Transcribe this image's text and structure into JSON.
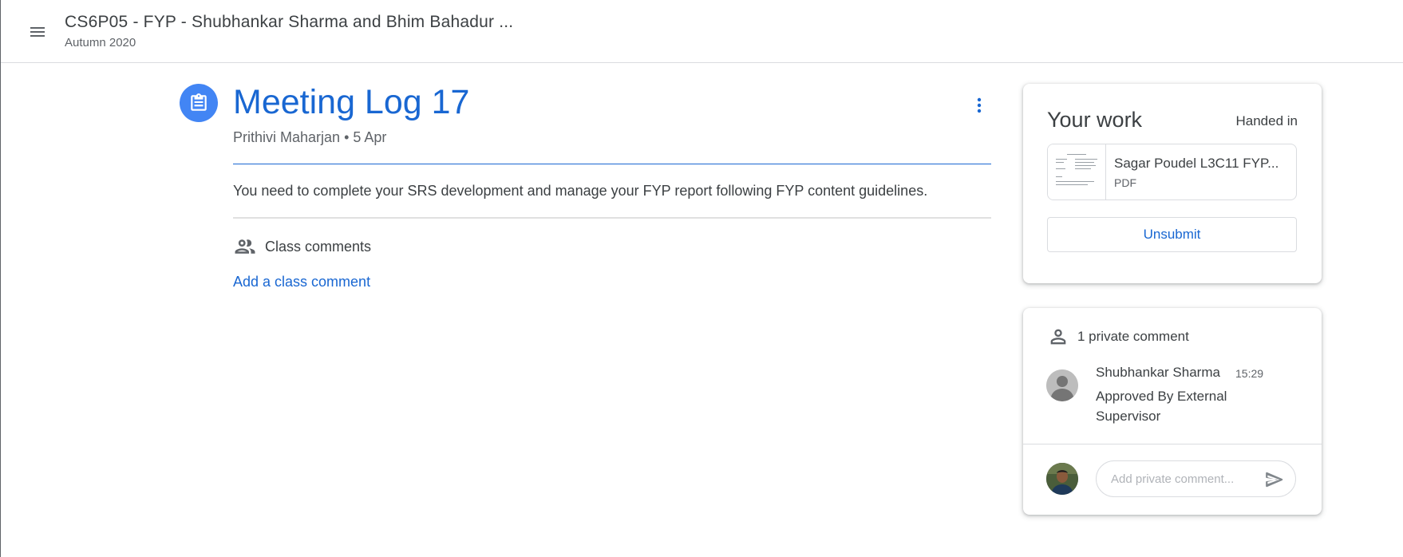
{
  "header": {
    "class_title": "CS6P05 - FYP - Shubhankar Sharma and Bhim Bahadur ...",
    "class_subtitle": "Autumn 2020"
  },
  "assignment": {
    "title": "Meeting Log 17",
    "author": "Prithivi Maharjan",
    "date": "5 Apr",
    "instructions": "You need to complete your SRS development and manage your FYP report following FYP content guidelines.",
    "class_comments_label": "Class comments",
    "add_class_comment": "Add a class comment"
  },
  "your_work": {
    "title": "Your work",
    "status": "Handed in",
    "attachment": {
      "name": "Sagar Poudel L3C11 FYP...",
      "type": "PDF"
    },
    "unsubmit_label": "Unsubmit"
  },
  "private_comments": {
    "header": "1 private comment",
    "comments": [
      {
        "author": "Shubhankar Sharma",
        "time": "15:29",
        "text": "Approved By External Supervisor"
      }
    ],
    "input_placeholder": "Add private comment..."
  },
  "colors": {
    "accent": "#1967d2",
    "icon_bg": "#4285f4",
    "text": "#3c4043",
    "muted": "#5f6368",
    "border": "#dadce0"
  },
  "icons": {
    "menu": "hamburger-menu-icon",
    "assignment": "assignment-clipboard-icon",
    "more": "more-vert-icon",
    "class_comments": "people-icon",
    "private_comments": "person-icon",
    "send": "send-icon"
  }
}
